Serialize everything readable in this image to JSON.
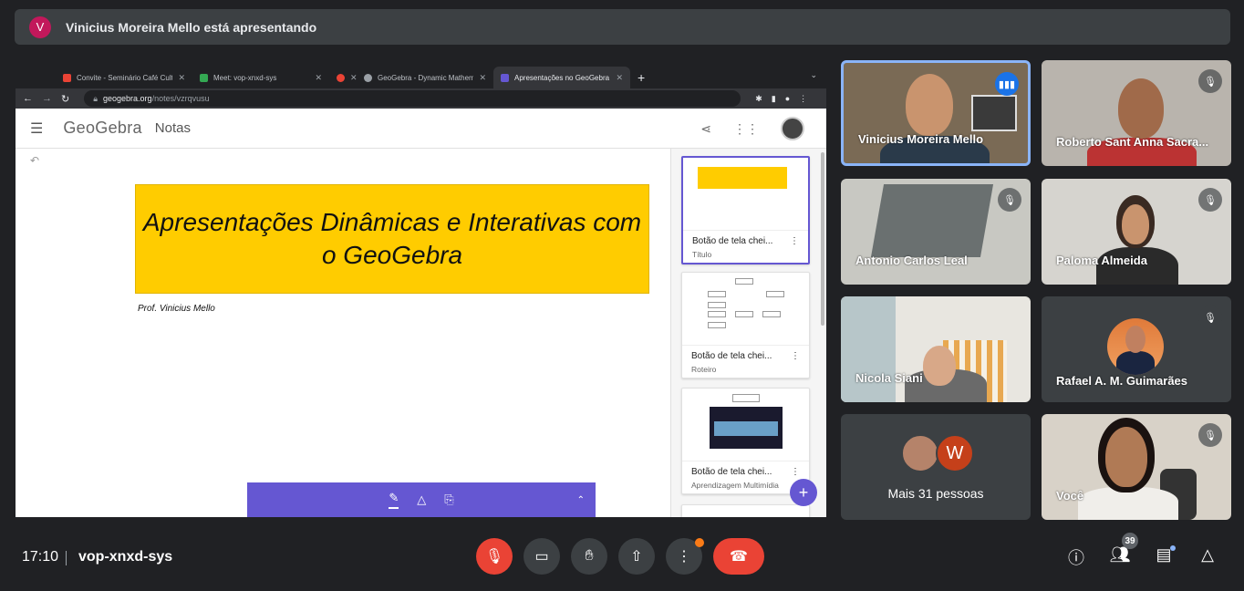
{
  "banner": {
    "avatar_letter": "V",
    "text": "Vinicius Moreira Mello está apresentando"
  },
  "browser": {
    "tabs": [
      {
        "label": "Convite - Seminário Café Cultu",
        "fav_color": "#ea4335"
      },
      {
        "label": "Meet: vop-xnxd-sys",
        "fav_color": "#34a853"
      },
      {
        "label": "",
        "fav_color": "#ea4335"
      },
      {
        "label": "GeoGebra - Dynamic Mathemat",
        "fav_color": "#9aa0a6"
      },
      {
        "label": "Apresentações no GeoGebra",
        "fav_color": "#6557d2"
      }
    ],
    "url_host": "geogebra.org",
    "url_path": "/notes/vzrqvusu"
  },
  "geogebra": {
    "logo": "GeoGebra",
    "app_name": "Notas",
    "slide_title": "Apresentações Dinâmicas e Interativas com o GeoGebra",
    "slide_author": "Prof. Vinicius Mello",
    "cards": [
      {
        "title": "Botão de tela chei...",
        "subtitle": "Título"
      },
      {
        "title": "Botão de tela chei...",
        "subtitle": "Roteiro"
      },
      {
        "title": "Botão de tela chei...",
        "subtitle": "Aprendizagem Multimídia"
      }
    ]
  },
  "participants": [
    {
      "name": "Vinicius Moreira Mello",
      "status": "speaking"
    },
    {
      "name": "Roberto Sant Anna Sacra...",
      "status": "muted"
    },
    {
      "name": "Antonio Carlos Leal",
      "status": "muted"
    },
    {
      "name": "Paloma Almeida",
      "status": "muted"
    },
    {
      "name": "Nicola Siani",
      "status": ""
    },
    {
      "name": "Rafael A. M. Guimarães",
      "status": "muted"
    },
    {
      "name": "Você",
      "status": "muted"
    }
  ],
  "more_people": {
    "avatar_letter": "W",
    "label": "Mais 31 pessoas"
  },
  "bottom_bar": {
    "time": "17:10",
    "meeting_code": "vop-xnxd-sys",
    "people_count": "39"
  },
  "colors": {
    "accent": "#6557d2",
    "hangup": "#ea4335",
    "speaking": "#1a73e8",
    "slide_bg": "#ffcc00"
  }
}
